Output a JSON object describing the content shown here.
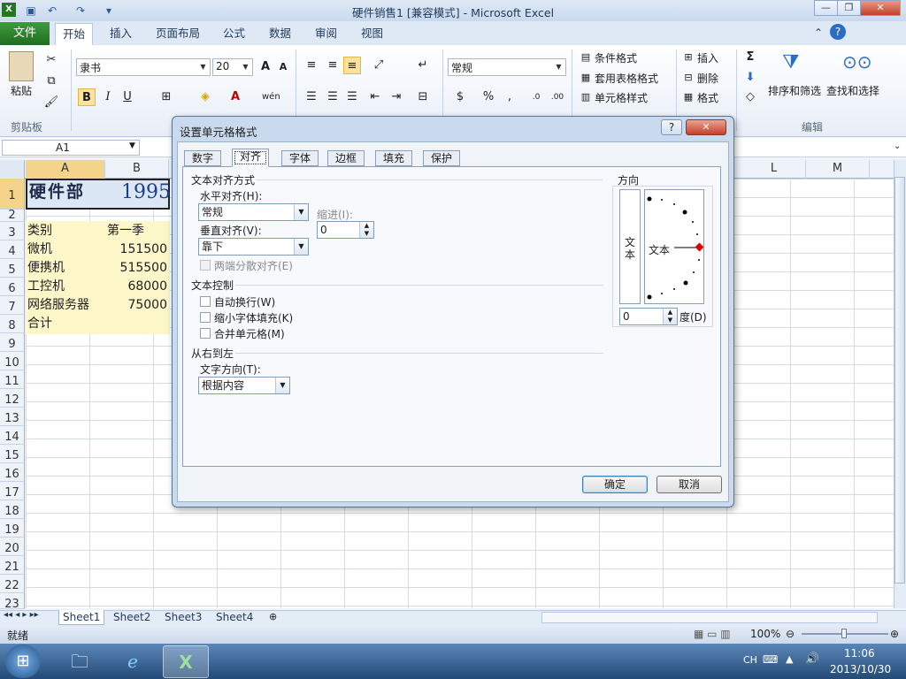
{
  "window": {
    "title": "硬件销售1 [兼容模式] - Microsoft Excel",
    "app_icon": "excel-icon"
  },
  "ribbon_tabs": {
    "file": "文件",
    "tabs": [
      "开始",
      "插入",
      "页面布局",
      "公式",
      "数据",
      "审阅",
      "视图"
    ],
    "active": "开始"
  },
  "ribbon": {
    "clipboard": {
      "paste": "粘贴",
      "group": "剪贴板"
    },
    "font": {
      "name": "隶书",
      "size": "20"
    },
    "number": {
      "format": "常规"
    },
    "styles": {
      "conditional": "条件格式",
      "table": "套用表格格式",
      "cell": "单元格样式"
    },
    "cells": {
      "insert": "插入",
      "delete": "删除",
      "format": "格式"
    },
    "editing": {
      "sort": "排序和筛选",
      "find": "查找和选择",
      "group": "编辑"
    }
  },
  "namebox": {
    "value": "A1"
  },
  "columns": [
    "A",
    "B",
    "L",
    "M"
  ],
  "rows": [
    "1",
    "2",
    "3",
    "4",
    "5",
    "6",
    "7",
    "8",
    "9",
    "10",
    "11",
    "12",
    "13",
    "14",
    "15",
    "16",
    "17",
    "18",
    "19",
    "20",
    "21",
    "22",
    "23"
  ],
  "cells": {
    "a1": "硬件部",
    "b1": "1995",
    "a3": "类别",
    "b3": "第一季",
    "a4": "微机",
    "b4": "151500",
    "a5": "便携机",
    "b5": "515500",
    "a6": "工控机",
    "b6": "68000",
    "a7": "网络服务器",
    "b7": "75000",
    "a8": "合计"
  },
  "sheets": [
    "Sheet1",
    "Sheet2",
    "Sheet3",
    "Sheet4"
  ],
  "status": {
    "ready": "就绪",
    "zoom": "100%"
  },
  "taskbar": {
    "lang": "CH",
    "time": "11:06",
    "date": "2013/10/30"
  },
  "dialog": {
    "title": "设置单元格格式",
    "help": "?",
    "tabs": [
      "数字",
      "对齐",
      "字体",
      "边框",
      "填充",
      "保护"
    ],
    "active_tab": "对齐",
    "alignment": {
      "section": "文本对齐方式",
      "horizontal_label": "水平对齐(H):",
      "horizontal_value": "常规",
      "indent_label": "缩进(I):",
      "indent_value": "0",
      "vertical_label": "垂直对齐(V):",
      "vertical_value": "靠下",
      "justify_distributed": "两端分散对齐(E)"
    },
    "control": {
      "section": "文本控制",
      "wrap": "自动换行(W)",
      "shrink": "缩小字体填充(K)",
      "merge": "合并单元格(M)"
    },
    "rtl": {
      "section": "从右到左",
      "direction_label": "文字方向(T):",
      "direction_value": "根据内容"
    },
    "orientation": {
      "section": "方向",
      "vertical_text": "文本",
      "horizontal_text": "文本",
      "degrees_value": "0",
      "degrees_label": "度(D)"
    },
    "ok": "确定",
    "cancel": "取消"
  }
}
